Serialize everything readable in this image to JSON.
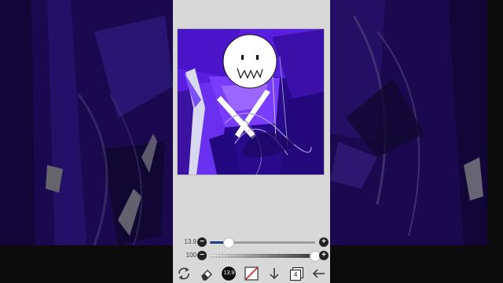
{
  "app": {
    "title": ""
  },
  "sliders": {
    "brush_size": {
      "value_text": "13.9",
      "level": 0.18
    },
    "opacity": {
      "value_text": "100",
      "level": 1.0
    }
  },
  "toolbar": {
    "transform": {
      "icon": "transform-icon"
    },
    "eraser": {
      "icon": "eraser-icon"
    },
    "brush_size_text": "13.9",
    "color": {
      "icon": "color-swatch-icon",
      "value": "#ffffff"
    },
    "move_down": {
      "icon": "arrow-down-icon"
    },
    "layers_count": "4",
    "back": {
      "icon": "arrow-left-icon"
    }
  },
  "colors": {
    "canvas_purple_dark": "#2a0a8c",
    "canvas_purple": "#5a1ee0",
    "canvas_purple_light": "#8a55ff",
    "panel_bg": "#d8d8d8",
    "slider_fill": "#1e3f7a"
  }
}
